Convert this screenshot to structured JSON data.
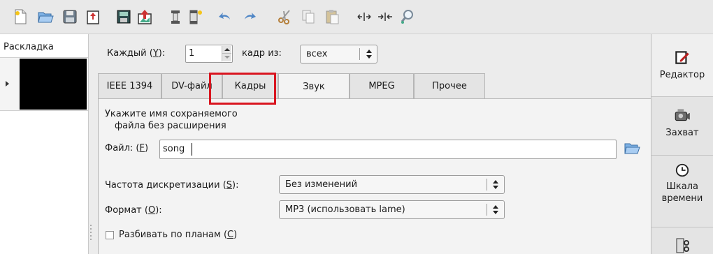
{
  "toolbar": {
    "buttons": [
      {
        "name": "new-file-icon"
      },
      {
        "name": "open-folder-icon"
      },
      {
        "name": "save-icon"
      },
      {
        "name": "export-icon"
      },
      {
        "name": "save-frame-icon"
      },
      {
        "name": "publish-icon"
      },
      {
        "name": "split-scene-icon"
      },
      {
        "name": "insert-frame-icon"
      },
      {
        "name": "undo-icon"
      },
      {
        "name": "redo-icon"
      },
      {
        "name": "cut-icon"
      },
      {
        "name": "copy-icon"
      },
      {
        "name": "paste-icon"
      },
      {
        "name": "expand-timeline-icon"
      },
      {
        "name": "compress-timeline-icon"
      },
      {
        "name": "zoom-icon"
      }
    ]
  },
  "left_panel": {
    "title": "Раскладка"
  },
  "frame_controls": {
    "every_label_pre": "Каждый (",
    "every_label_key": "Y",
    "every_label_post": "):",
    "every_value": "1",
    "frame_of_label": "кадр из:",
    "frame_of_value": "всех"
  },
  "tabs": [
    {
      "label": "IEEE 1394"
    },
    {
      "label": "DV-файл"
    },
    {
      "label": "Кадры"
    },
    {
      "label": "Звук",
      "active": true
    },
    {
      "label": "MPEG"
    },
    {
      "label": "Прочее"
    }
  ],
  "sound_tab": {
    "instruction_line1": "Укажите имя сохраняемого",
    "instruction_line2": "файла без расширения",
    "file_label_pre": "Файл: (",
    "file_label_key": "F",
    "file_label_post": ")",
    "file_value": "song",
    "sample_rate_label_pre": "Частота дискретизации (",
    "sample_rate_label_key": "S",
    "sample_rate_label_post": "):",
    "sample_rate_value": "Без изменений",
    "format_label_pre": "Формат (",
    "format_label_key": "O",
    "format_label_post": "):",
    "format_value": "MP3 (использовать lame)",
    "split_label_pre": "Разбивать по планам (",
    "split_label_key": "C",
    "split_label_post": ")",
    "split_checked": false
  },
  "right_bar": {
    "editor_label": "Редактор",
    "capture_label": "Захват",
    "timeline_label_line1": "Шкала",
    "timeline_label_line2": "времени"
  },
  "colors": {
    "highlight": "#d9151f",
    "background": "#ececec"
  }
}
